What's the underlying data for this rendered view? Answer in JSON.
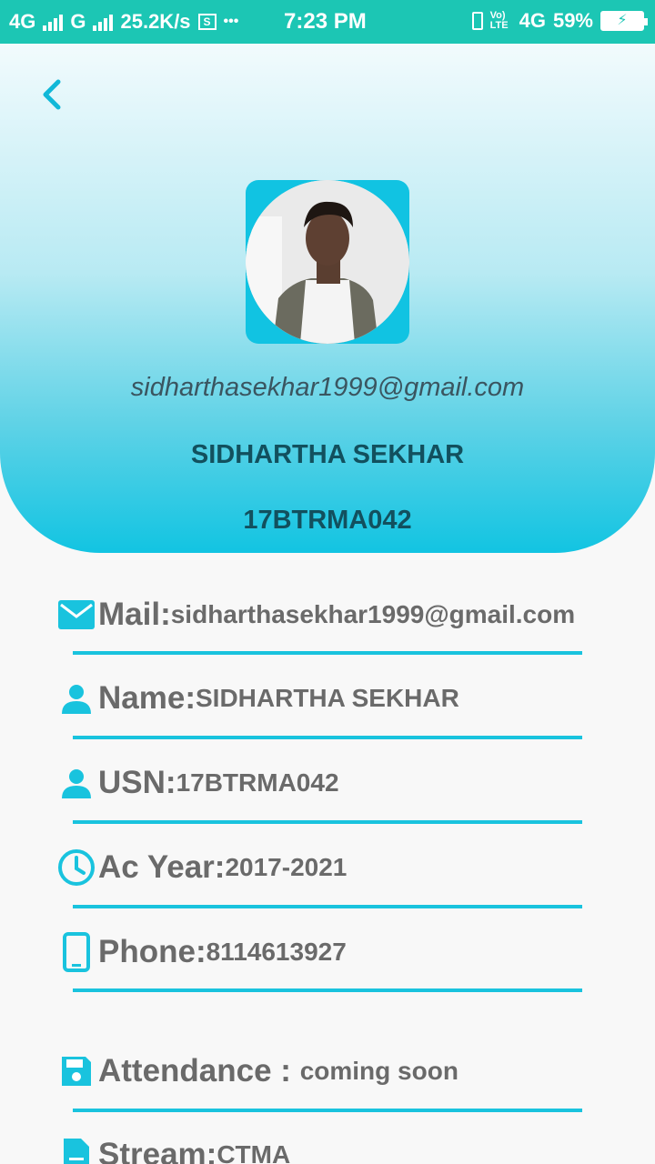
{
  "status_bar": {
    "network1": "4G",
    "network2": "G",
    "speed": "25.2K/s",
    "more": "•••",
    "time": "7:23 PM",
    "volte": "Vo) LTE",
    "network3": "4G",
    "battery": "59%"
  },
  "header": {
    "email": "sidharthasekhar1999@gmail.com",
    "name": "SIDHARTHA SEKHAR",
    "usn": "17BTRMA042"
  },
  "rows": [
    {
      "icon": "mail-icon",
      "label": "Mail:",
      "value": "sidharthasekhar1999@gmail.com"
    },
    {
      "icon": "person-icon",
      "label": "Name:",
      "value": "SIDHARTHA SEKHAR"
    },
    {
      "icon": "person-icon",
      "label": "USN:",
      "value": "17BTRMA042"
    },
    {
      "icon": "clock-icon",
      "label": "Ac Year:",
      "value": "2017-2021"
    },
    {
      "icon": "phone-icon",
      "label": "Phone:",
      "value": "8114613927"
    },
    {
      "icon": "save-icon",
      "label": "Attendance : ",
      "value": "coming soon"
    },
    {
      "icon": "document-icon",
      "label": "Stream:",
      "value": "CTMA"
    }
  ],
  "colors": {
    "accent": "#19c3de",
    "status_bar": "#1cc6b4",
    "text": "#6a6a6a"
  }
}
